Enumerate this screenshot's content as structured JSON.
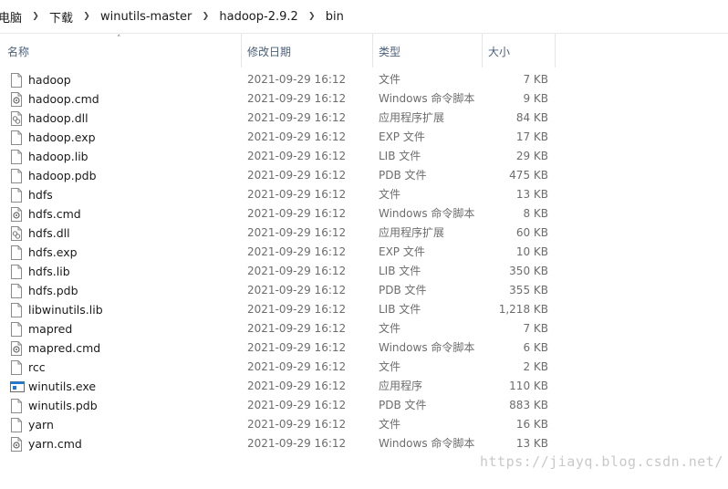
{
  "breadcrumb": {
    "items": [
      "电脑",
      "下载",
      "winutils-master",
      "hadoop-2.9.2",
      "bin"
    ]
  },
  "columns": {
    "name": "名称",
    "date": "修改日期",
    "type": "类型",
    "size": "大小"
  },
  "files": [
    {
      "name": "hadoop",
      "date": "2021-09-29 16:12",
      "type": "文件",
      "size": "7 KB",
      "icon": "file-icon"
    },
    {
      "name": "hadoop.cmd",
      "date": "2021-09-29 16:12",
      "type": "Windows 命令脚本",
      "size": "9 KB",
      "icon": "cmd-script-icon"
    },
    {
      "name": "hadoop.dll",
      "date": "2021-09-29 16:12",
      "type": "应用程序扩展",
      "size": "84 KB",
      "icon": "dll-icon"
    },
    {
      "name": "hadoop.exp",
      "date": "2021-09-29 16:12",
      "type": "EXP 文件",
      "size": "17 KB",
      "icon": "file-icon"
    },
    {
      "name": "hadoop.lib",
      "date": "2021-09-29 16:12",
      "type": "LIB 文件",
      "size": "29 KB",
      "icon": "file-icon"
    },
    {
      "name": "hadoop.pdb",
      "date": "2021-09-29 16:12",
      "type": "PDB 文件",
      "size": "475 KB",
      "icon": "file-icon"
    },
    {
      "name": "hdfs",
      "date": "2021-09-29 16:12",
      "type": "文件",
      "size": "13 KB",
      "icon": "file-icon"
    },
    {
      "name": "hdfs.cmd",
      "date": "2021-09-29 16:12",
      "type": "Windows 命令脚本",
      "size": "8 KB",
      "icon": "cmd-script-icon"
    },
    {
      "name": "hdfs.dll",
      "date": "2021-09-29 16:12",
      "type": "应用程序扩展",
      "size": "60 KB",
      "icon": "dll-icon"
    },
    {
      "name": "hdfs.exp",
      "date": "2021-09-29 16:12",
      "type": "EXP 文件",
      "size": "10 KB",
      "icon": "file-icon"
    },
    {
      "name": "hdfs.lib",
      "date": "2021-09-29 16:12",
      "type": "LIB 文件",
      "size": "350 KB",
      "icon": "file-icon"
    },
    {
      "name": "hdfs.pdb",
      "date": "2021-09-29 16:12",
      "type": "PDB 文件",
      "size": "355 KB",
      "icon": "file-icon"
    },
    {
      "name": "libwinutils.lib",
      "date": "2021-09-29 16:12",
      "type": "LIB 文件",
      "size": "1,218 KB",
      "icon": "file-icon"
    },
    {
      "name": "mapred",
      "date": "2021-09-29 16:12",
      "type": "文件",
      "size": "7 KB",
      "icon": "file-icon"
    },
    {
      "name": "mapred.cmd",
      "date": "2021-09-29 16:12",
      "type": "Windows 命令脚本",
      "size": "6 KB",
      "icon": "cmd-script-icon"
    },
    {
      "name": "rcc",
      "date": "2021-09-29 16:12",
      "type": "文件",
      "size": "2 KB",
      "icon": "file-icon"
    },
    {
      "name": "winutils.exe",
      "date": "2021-09-29 16:12",
      "type": "应用程序",
      "size": "110 KB",
      "icon": "exe-icon"
    },
    {
      "name": "winutils.pdb",
      "date": "2021-09-29 16:12",
      "type": "PDB 文件",
      "size": "883 KB",
      "icon": "file-icon"
    },
    {
      "name": "yarn",
      "date": "2021-09-29 16:12",
      "type": "文件",
      "size": "16 KB",
      "icon": "file-icon"
    },
    {
      "name": "yarn.cmd",
      "date": "2021-09-29 16:12",
      "type": "Windows 命令脚本",
      "size": "13 KB",
      "icon": "cmd-script-icon"
    }
  ],
  "watermark": "https://jiayq.blog.csdn.net/",
  "colors": {
    "header_text": "#4c607a",
    "detail_text": "#6d6d6d",
    "exe_icon_accent": "#1e78d7"
  }
}
